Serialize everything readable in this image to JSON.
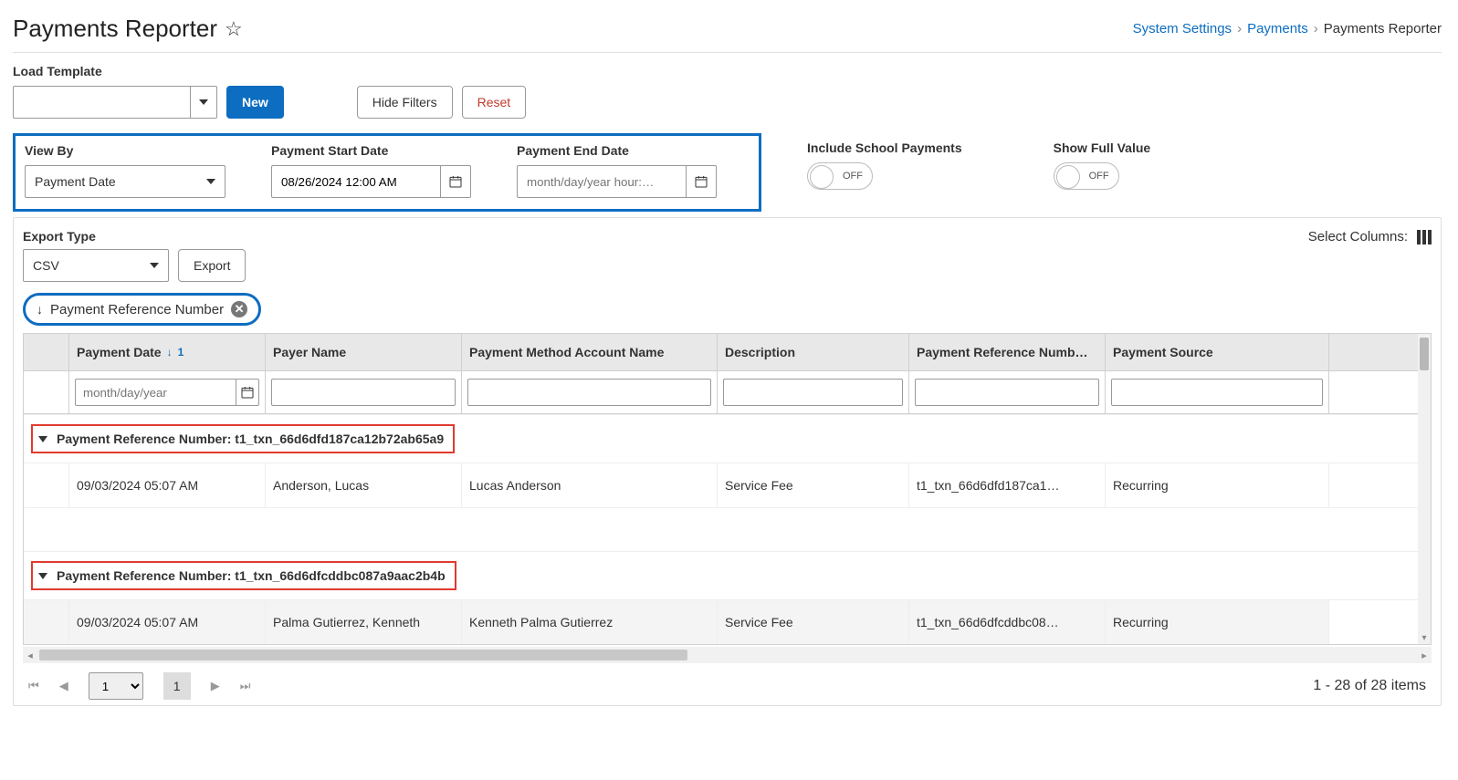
{
  "page": {
    "title": "Payments Reporter"
  },
  "breadcrumb": {
    "i0": "System Settings",
    "i1": "Payments",
    "i2": "Payments Reporter"
  },
  "template": {
    "label": "Load Template",
    "value": "",
    "new": "New"
  },
  "buttons": {
    "hide_filters": "Hide Filters",
    "reset": "Reset",
    "export": "Export"
  },
  "filters": {
    "view_by_label": "View By",
    "view_by_value": "Payment Date",
    "start_label": "Payment Start Date",
    "start_value": "08/26/2024 12:00 AM",
    "end_label": "Payment End Date",
    "end_placeholder": "month/day/year hour:…",
    "include_school": "Include School Payments",
    "show_full": "Show Full Value",
    "off": "OFF"
  },
  "export": {
    "label": "Export Type",
    "value": "CSV",
    "select_columns": "Select Columns:"
  },
  "chip": {
    "label": "Payment Reference Number"
  },
  "columns": {
    "c0_label": "Payment Date",
    "c0_sort": "1",
    "c1": "Payer Name",
    "c2": "Payment Method Account Name",
    "c3": "Description",
    "c4": "Payment Reference Numb…",
    "c5": "Payment Source",
    "date_placeholder": "month/day/year"
  },
  "group_prefix": "Payment Reference Number: ",
  "groups": {
    "g0": {
      "ref": "t1_txn_66d6dfd187ca12b72ab65a9",
      "row": {
        "date": "09/03/2024 05:07 AM",
        "payer": "Anderson, Lucas",
        "account": "Lucas Anderson",
        "desc": "Service Fee",
        "ref": "t1_txn_66d6dfd187ca1…",
        "source": "Recurring"
      }
    },
    "g1": {
      "ref": "t1_txn_66d6dfcddbc087a9aac2b4b",
      "row": {
        "date": "09/03/2024 05:07 AM",
        "payer": "Palma Gutierrez, Kenneth",
        "account": "Kenneth Palma Gutierrez",
        "desc": "Service Fee",
        "ref": "t1_txn_66d6dfcddbc08…",
        "source": "Recurring"
      }
    }
  },
  "pager": {
    "page": "1",
    "cur": "1",
    "info": "1 - 28 of 28 items"
  }
}
